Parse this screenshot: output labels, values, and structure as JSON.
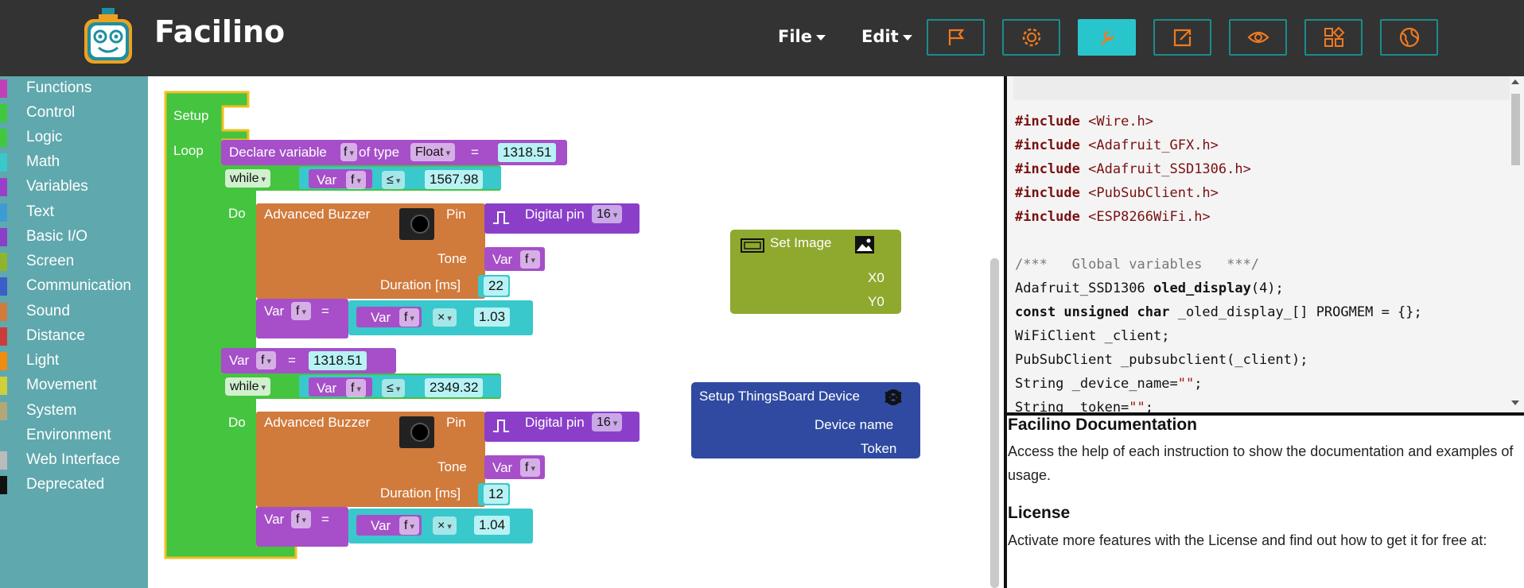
{
  "app": {
    "title": "Facilino"
  },
  "menus": [
    {
      "label": "File"
    },
    {
      "label": "Edit"
    }
  ],
  "toolbar": [
    {
      "icon": "flag-icon",
      "active": false
    },
    {
      "icon": "gear-icon",
      "active": false
    },
    {
      "icon": "wrench-icon",
      "active": true
    },
    {
      "icon": "export-icon",
      "active": false
    },
    {
      "icon": "eye-icon",
      "active": false
    },
    {
      "icon": "shapes-icon",
      "active": false
    },
    {
      "icon": "globe-icon",
      "active": false
    }
  ],
  "categories": [
    {
      "label": "Functions",
      "color": "#c23fb9"
    },
    {
      "label": "Control",
      "color": "#41c83f"
    },
    {
      "label": "Logic",
      "color": "#41c83f"
    },
    {
      "label": "Math",
      "color": "#39c8cc"
    },
    {
      "label": "Variables",
      "color": "#9b3fc9"
    },
    {
      "label": "Text",
      "color": "#3f9bd4"
    },
    {
      "label": "Basic I/O",
      "color": "#8b3fc9"
    },
    {
      "label": "Screen",
      "color": "#8fb52e"
    },
    {
      "label": "Communication",
      "color": "#3b5fc9"
    },
    {
      "label": "Sound",
      "color": "#d07a3c"
    },
    {
      "label": "Distance",
      "color": "#cc3b3b"
    },
    {
      "label": "Light",
      "color": "#f08c10"
    },
    {
      "label": "Movement",
      "color": "#cfcf3a"
    },
    {
      "label": "System",
      "color": "#b3a77a"
    },
    {
      "label": "Environment",
      "color": "#5fa8ad"
    },
    {
      "label": "Web Interface",
      "color": "#bbbbbb"
    },
    {
      "label": "Deprecated",
      "color": "#111111"
    }
  ],
  "blocks": {
    "setup": "Setup",
    "loop": "Loop",
    "declare": {
      "label": "Declare variable",
      "name": "f",
      "oftype": "of type",
      "type": "Float",
      "eq": "=",
      "value": "1318.51"
    },
    "while1": {
      "label": "while",
      "var": "Var",
      "name": "f",
      "op": "≤",
      "value": "1567.98",
      "do": "Do"
    },
    "buzzer1": {
      "label": "Advanced Buzzer",
      "pin": "Pin",
      "digital": "Digital pin",
      "pinval": "16",
      "tone": "Tone",
      "var": "Var",
      "name": "f",
      "duration": "Duration [ms]",
      "durval": "22"
    },
    "assign1": {
      "var": "Var",
      "name": "f",
      "eq": "=",
      "var2": "Var",
      "name2": "f",
      "op": "×",
      "value": "1.03"
    },
    "set2": {
      "var": "Var",
      "name": "f",
      "eq": "=",
      "value": "1318.51"
    },
    "while2": {
      "label": "while",
      "var": "Var",
      "name": "f",
      "op": "≤",
      "value": "2349.32",
      "do": "Do"
    },
    "buzzer2": {
      "label": "Advanced Buzzer",
      "pin": "Pin",
      "digital": "Digital pin",
      "pinval": "16",
      "tone": "Tone",
      "var": "Var",
      "name": "f",
      "duration": "Duration [ms]",
      "durval": "12"
    },
    "assign2": {
      "var": "Var",
      "name": "f",
      "eq": "=",
      "var2": "Var",
      "name2": "f",
      "op": "×",
      "value": "1.04"
    },
    "setimage": {
      "label": "Set Image",
      "x0": "X0",
      "y0": "Y0"
    },
    "thingsboard": {
      "label": "Setup ThingsBoard Device",
      "devname": "Device name",
      "token": "Token"
    }
  },
  "code": {
    "includes": [
      {
        "kw": "#include",
        "file": "<Wire.h>"
      },
      {
        "kw": "#include",
        "file": "<Adafruit_GFX.h>"
      },
      {
        "kw": "#include",
        "file": "<Adafruit_SSD1306.h>"
      },
      {
        "kw": "#include",
        "file": "<PubSubClient.h>"
      },
      {
        "kw": "#include",
        "file": "<ESP8266WiFi.h>"
      }
    ],
    "comment": "/***   Global variables   ***/",
    "line1a": "Adafruit_SSD1306 ",
    "line1b": "oled_display",
    "line1c": "(4);",
    "line2a": "const unsigned char",
    "line2b": " _oled_display_[] PROGMEM = {};",
    "line3": "WiFiClient _client;",
    "line4": "PubSubClient _pubsubclient(_client);",
    "line5a": "String _device_name=",
    "line5b": "\"\"",
    "line5c": ";",
    "line6a": "String _token=",
    "line6b": "\"\"",
    "line6c": ";"
  },
  "docs": {
    "title": "Facilino Documentation",
    "text": "Access the help of each instruction to show the documentation and examples of usage.",
    "license_title": "License",
    "license_text": "Activate more features with the License and find out how to get it for free at:"
  }
}
